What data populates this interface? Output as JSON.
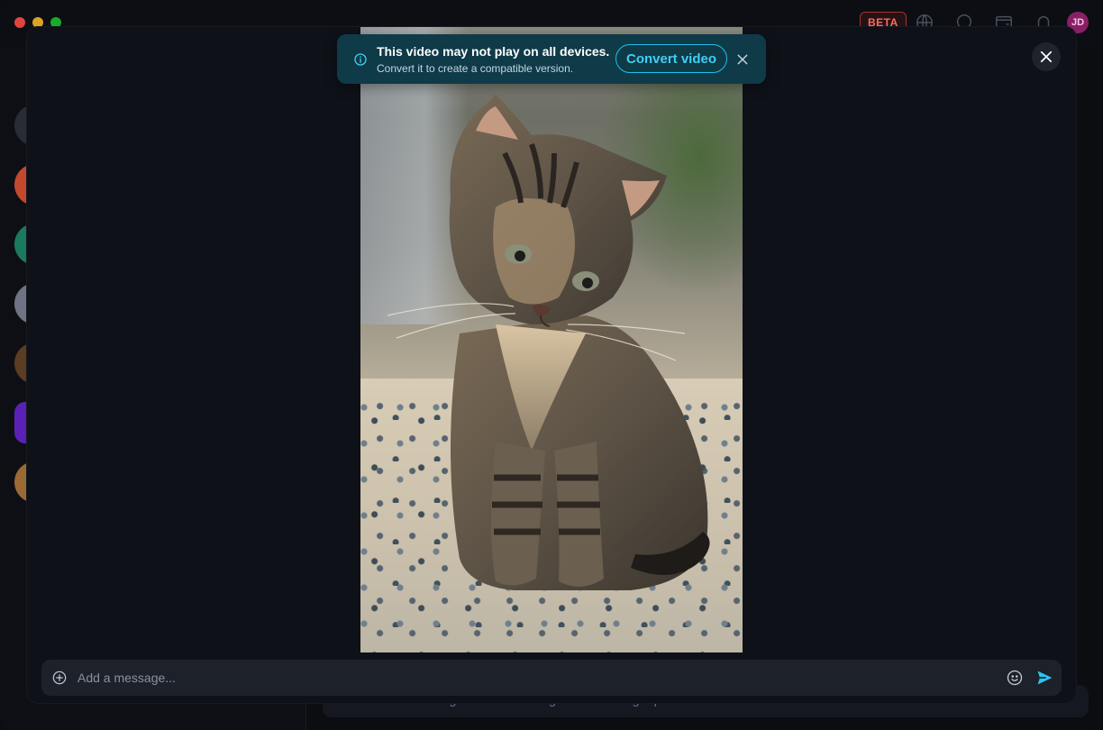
{
  "header": {
    "badge": "BETA",
    "avatar_initials": "JD"
  },
  "banner": {
    "title": "This video may not play on all devices.",
    "subtitle": "Convert it to create a compatible version.",
    "action_label": "Convert video"
  },
  "composer": {
    "placeholder": "Add a message...",
    "background_text": "consectetur. Fringilla hendrerit in eget laoreet integer pretium ac."
  },
  "colors": {
    "banner_bg": "#0f3a48",
    "accent": "#1ec2e8",
    "modal_bg": "#0e1118",
    "beta": "#ff6a5c"
  },
  "icons": {
    "info": "info-icon",
    "close": "close-icon",
    "add": "plus-circle-icon",
    "emoji": "smiley-icon",
    "send": "send-icon"
  }
}
